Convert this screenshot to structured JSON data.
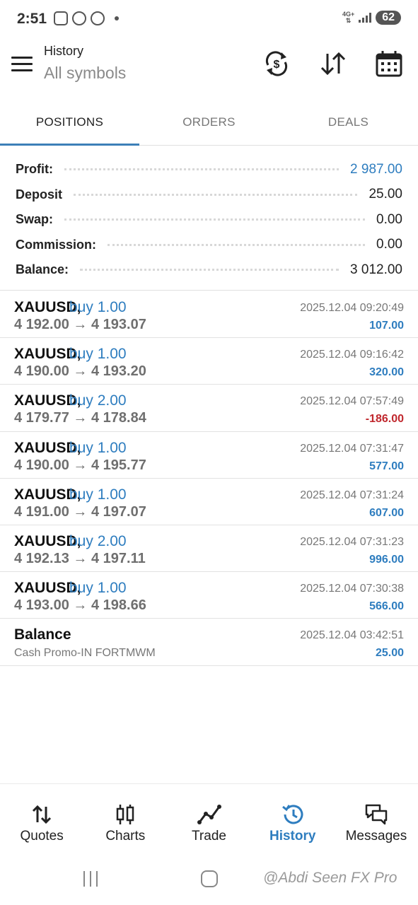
{
  "status_bar": {
    "time": "2:51",
    "network": "4G+",
    "battery": "62",
    "left_icons": [
      "screenshot-icon",
      "plus-circle-icon",
      "whatsapp-icon"
    ]
  },
  "header": {
    "title": "History",
    "subtitle": "All symbols",
    "icons": [
      "menu-icon",
      "currency-sync-icon",
      "sort-icon",
      "calendar-icon"
    ]
  },
  "tabs": [
    {
      "label": "POSITIONS",
      "active": true
    },
    {
      "label": "ORDERS",
      "active": false
    },
    {
      "label": "DEALS",
      "active": false
    }
  ],
  "summary": [
    {
      "label": "Profit:",
      "value": "2 987.00",
      "accent": true
    },
    {
      "label": "Deposit",
      "value": "25.00",
      "accent": false
    },
    {
      "label": "Swap:",
      "value": "0.00",
      "accent": false
    },
    {
      "label": "Commission:",
      "value": "0.00",
      "accent": false
    },
    {
      "label": "Balance:",
      "value": "3 012.00",
      "accent": false
    }
  ],
  "deals": [
    {
      "symbol": "XAUUSD,",
      "type": "buy 1.00",
      "prices": "4 192.00 → 4 193.07",
      "datetime": "2025.12.04 09:20:49",
      "profit": "107.00",
      "negative": false
    },
    {
      "symbol": "XAUUSD,",
      "type": "buy 1.00",
      "prices": "4 190.00 → 4 193.20",
      "datetime": "2025.12.04 09:16:42",
      "profit": "320.00",
      "negative": false
    },
    {
      "symbol": "XAUUSD,",
      "type": "buy 2.00",
      "prices": "4 179.77 → 4 178.84",
      "datetime": "2025.12.04 07:57:49",
      "profit": "-186.00",
      "negative": true
    },
    {
      "symbol": "XAUUSD,",
      "type": "buy 1.00",
      "prices": "4 190.00 → 4 195.77",
      "datetime": "2025.12.04 07:31:47",
      "profit": "577.00",
      "negative": false
    },
    {
      "symbol": "XAUUSD,",
      "type": "buy 1.00",
      "prices": "4 191.00 → 4 197.07",
      "datetime": "2025.12.04 07:31:24",
      "profit": "607.00",
      "negative": false
    },
    {
      "symbol": "XAUUSD,",
      "type": "buy 2.00",
      "prices": "4 192.13 → 4 197.11",
      "datetime": "2025.12.04 07:31:23",
      "profit": "996.00",
      "negative": false
    },
    {
      "symbol": "XAUUSD,",
      "type": "buy 1.00",
      "prices": "4 193.00 → 4 198.66",
      "datetime": "2025.12.04 07:30:38",
      "profit": "566.00",
      "negative": false
    }
  ],
  "balance_entry": {
    "title": "Balance",
    "comment": "Cash Promo-IN FORTMWM",
    "datetime": "2025.12.04 03:42:51",
    "amount": "25.00"
  },
  "bottom_nav": [
    {
      "label": "Quotes",
      "icon": "quotes-icon",
      "active": false
    },
    {
      "label": "Charts",
      "icon": "candlestick-icon",
      "active": false
    },
    {
      "label": "Trade",
      "icon": "trade-icon",
      "active": false
    },
    {
      "label": "History",
      "icon": "history-icon",
      "active": true
    },
    {
      "label": "Messages",
      "icon": "messages-icon",
      "active": false
    }
  ],
  "watermark": "@Abdi Seen FX Pro",
  "colors": {
    "accent": "#2e7dbf",
    "negative": "#c0272d",
    "tab_indicator": "#3d7fb8"
  }
}
